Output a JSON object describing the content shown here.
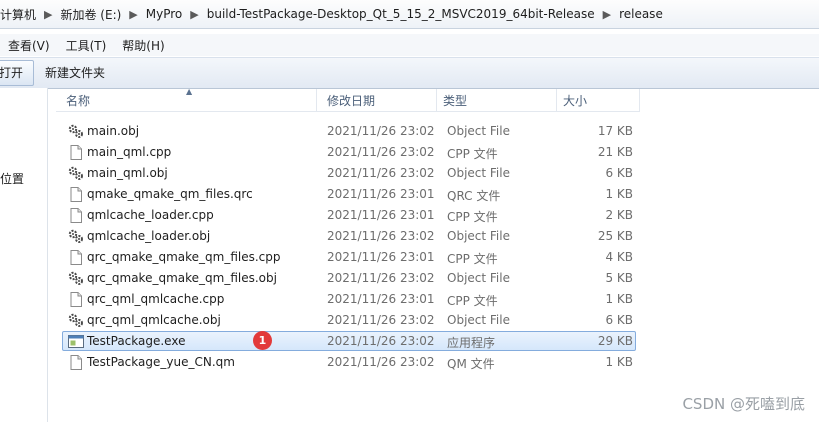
{
  "breadcrumb": [
    "计算机",
    "新加卷 (E:)",
    "MyPro",
    "build-TestPackage-Desktop_Qt_5_15_2_MSVC2019_64bit-Release",
    "release"
  ],
  "menu": [
    "查看(V)",
    "工具(T)",
    "帮助(H)"
  ],
  "toolbar": {
    "open_label": "打开",
    "new_folder_label": "新建文件夹"
  },
  "nav": {
    "location_label": "位置"
  },
  "columns": {
    "name": "名称",
    "date": "修改日期",
    "type": "类型",
    "size": "大小"
  },
  "files": [
    {
      "name": "main.obj",
      "date": "2021/11/26 23:02",
      "type": "Object File",
      "size": "17 KB",
      "icon": "object-file-icon"
    },
    {
      "name": "main_qml.cpp",
      "date": "2021/11/26 23:02",
      "type": "CPP 文件",
      "size": "21 KB",
      "icon": "document-icon"
    },
    {
      "name": "main_qml.obj",
      "date": "2021/11/26 23:02",
      "type": "Object File",
      "size": "6 KB",
      "icon": "object-file-icon"
    },
    {
      "name": "qmake_qmake_qm_files.qrc",
      "date": "2021/11/26 23:01",
      "type": "QRC 文件",
      "size": "1 KB",
      "icon": "document-icon"
    },
    {
      "name": "qmlcache_loader.cpp",
      "date": "2021/11/26 23:01",
      "type": "CPP 文件",
      "size": "2 KB",
      "icon": "document-icon"
    },
    {
      "name": "qmlcache_loader.obj",
      "date": "2021/11/26 23:02",
      "type": "Object File",
      "size": "25 KB",
      "icon": "object-file-icon"
    },
    {
      "name": "qrc_qmake_qmake_qm_files.cpp",
      "date": "2021/11/26 23:01",
      "type": "CPP 文件",
      "size": "4 KB",
      "icon": "document-icon"
    },
    {
      "name": "qrc_qmake_qmake_qm_files.obj",
      "date": "2021/11/26 23:02",
      "type": "Object File",
      "size": "5 KB",
      "icon": "object-file-icon"
    },
    {
      "name": "qrc_qml_qmlcache.cpp",
      "date": "2021/11/26 23:01",
      "type": "CPP 文件",
      "size": "1 KB",
      "icon": "document-icon"
    },
    {
      "name": "qrc_qml_qmlcache.obj",
      "date": "2021/11/26 23:02",
      "type": "Object File",
      "size": "6 KB",
      "icon": "object-file-icon"
    },
    {
      "name": "TestPackage.exe",
      "date": "2021/11/26 23:02",
      "type": "应用程序",
      "size": "29 KB",
      "icon": "application-icon",
      "selected": true
    },
    {
      "name": "TestPackage_yue_CN.qm",
      "date": "2021/11/26 23:02",
      "type": "QM 文件",
      "size": "1 KB",
      "icon": "document-icon"
    }
  ],
  "annotation_badge": "1",
  "watermark": "CSDN @死嗑到底"
}
